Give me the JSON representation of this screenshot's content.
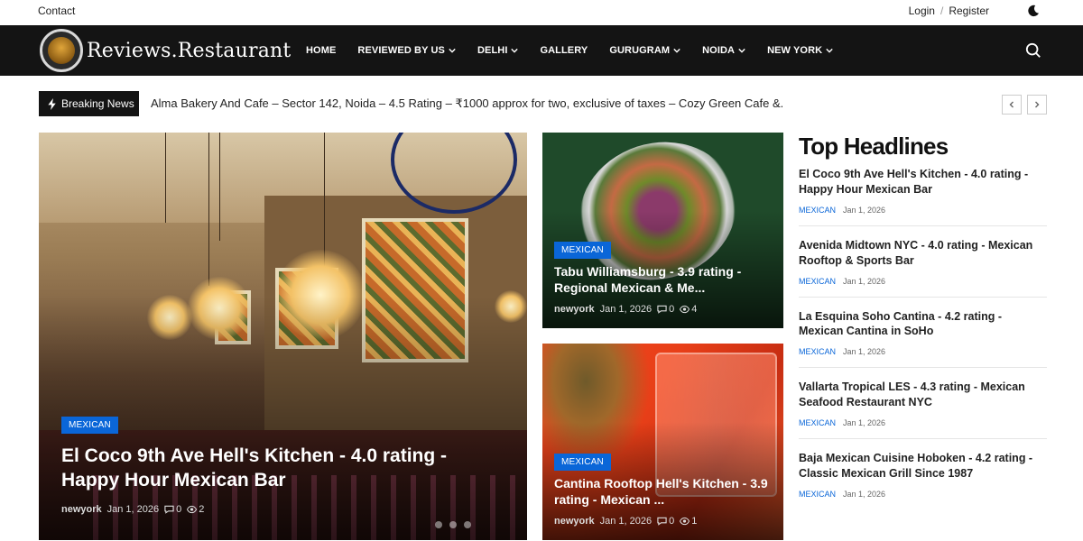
{
  "topbar": {
    "contact": "Contact",
    "login": "Login",
    "separator": "/",
    "register": "Register",
    "theme_icon": "moon-icon"
  },
  "nav": {
    "logo_text": "Reviews.Restaurant",
    "items": [
      {
        "label": "HOME",
        "dropdown": false
      },
      {
        "label": "REVIEWED BY US",
        "dropdown": true
      },
      {
        "label": "DELHI",
        "dropdown": true
      },
      {
        "label": "GALLERY",
        "dropdown": false
      },
      {
        "label": "GURUGRAM",
        "dropdown": true
      },
      {
        "label": "NOIDA",
        "dropdown": true
      },
      {
        "label": "NEW YORK",
        "dropdown": true
      }
    ],
    "search_icon": "search-icon"
  },
  "breaking": {
    "label": "Breaking News",
    "text": "Alma Bakery And Cafe – Sector 142, Noida – 4.5 Rating – ₹1000 approx for two, exclusive of taxes – Cozy Green Cafe &..."
  },
  "featured": {
    "category": "MEXICAN",
    "title": "El Coco 9th Ave Hell's Kitchen - 4.0 rating - Happy Hour Mexican Bar",
    "author": "newyork",
    "date": "Jan 1, 2026",
    "comments": "0",
    "views": "2"
  },
  "card2": {
    "category": "MEXICAN",
    "title": "Tabu Williamsburg - 3.9 rating - Regional Mexican & Me...",
    "author": "newyork",
    "date": "Jan 1, 2026",
    "comments": "0",
    "views": "4"
  },
  "card3": {
    "category": "MEXICAN",
    "title": "Cantina Rooftop Hell's Kitchen - 3.9 rating - Mexican ...",
    "author": "newyork",
    "date": "Jan 1, 2026",
    "comments": "0",
    "views": "1"
  },
  "headlines": {
    "title": "Top Headlines",
    "items": [
      {
        "title": "El Coco 9th Ave Hell's Kitchen - 4.0 rating - Happy Hour Mexican Bar",
        "category": "MEXICAN",
        "date": "Jan 1, 2026"
      },
      {
        "title": "Avenida Midtown NYC - 4.0 rating - Mexican Rooftop & Sports Bar",
        "category": "MEXICAN",
        "date": "Jan 1, 2026"
      },
      {
        "title": "La Esquina Soho Cantina - 4.2 rating - Mexican Cantina in SoHo",
        "category": "MEXICAN",
        "date": "Jan 1, 2026"
      },
      {
        "title": "Vallarta Tropical LES - 4.3 rating - Mexican Seafood Restaurant NYC",
        "category": "MEXICAN",
        "date": "Jan 1, 2026"
      },
      {
        "title": "Baja Mexican Cuisine Hoboken - 4.2 rating - Classic Mexican Grill Since 1987",
        "category": "MEXICAN",
        "date": "Jan 1, 2026"
      }
    ]
  },
  "colors": {
    "accent": "#0a66d8",
    "nav_bg": "#141414"
  }
}
